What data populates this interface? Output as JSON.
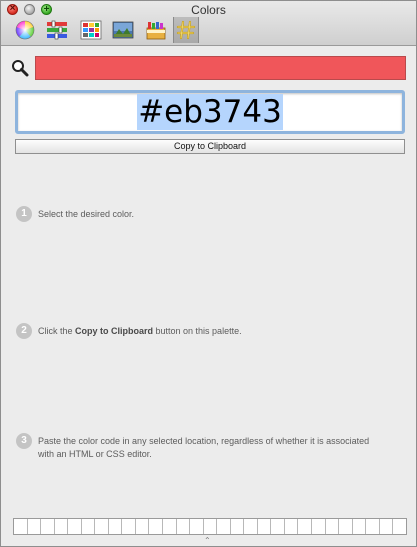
{
  "window": {
    "title": "Colors"
  },
  "toolbar": {
    "tabs": [
      {
        "icon": "color-wheel-icon"
      },
      {
        "icon": "color-sliders-icon"
      },
      {
        "icon": "color-palettes-icon"
      },
      {
        "icon": "image-palettes-icon"
      },
      {
        "icon": "crayons-icon"
      },
      {
        "icon": "hex-code-icon",
        "selected": true
      }
    ]
  },
  "search": {
    "icon": "magnifier-icon"
  },
  "current_color": {
    "hex": "#eb3743",
    "swatch_color": "#f0565a"
  },
  "copy_button": {
    "label": "Copy to Clipboard"
  },
  "steps": [
    {
      "number": "1",
      "text_before": "Select the desired color.",
      "bold": "",
      "text_after": ""
    },
    {
      "number": "2",
      "text_before": "Click the ",
      "bold": "Copy to Clipboard",
      "text_after": " button on this palette."
    },
    {
      "number": "3",
      "text_before": "Paste the color code in any selected location, regardless of whether it is associated with an HTML or CSS editor.",
      "bold": "",
      "text_after": ""
    }
  ],
  "swatch_tray": {
    "cell_count": 29
  }
}
